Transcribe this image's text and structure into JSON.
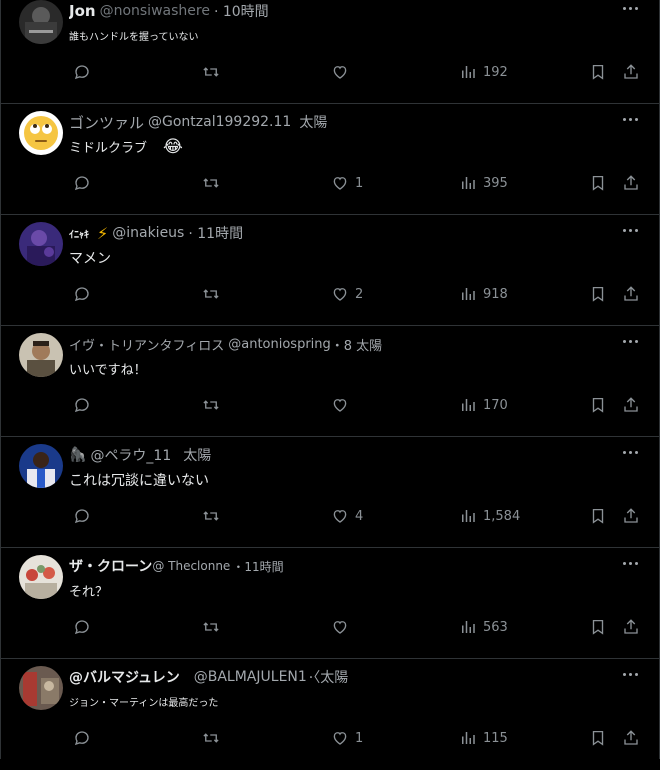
{
  "posts": [
    {
      "name": "Jon",
      "handle": "@nonsiwashere",
      "time": "· 10時間",
      "text": "誰もハンドルを握っていない",
      "likes": "",
      "views": "192",
      "avatar": "avatar-bw-photo"
    },
    {
      "name": "ゴンツァル",
      "handle": "@Gontzal199292.11",
      "time": "太陽",
      "text": "ミドルクラブ",
      "emoji": "😂",
      "likes": "1",
      "views": "395",
      "avatar": "avatar-rolling-eyes-emoji"
    },
    {
      "name": "ｲﾆｬｷ",
      "bolt": "⚡",
      "handle": "@inakieus",
      "time": "· 11時間",
      "text": "マメン",
      "likes": "2",
      "views": "918",
      "avatar": "avatar-purple-photo"
    },
    {
      "name": "イヴ・トリアンタフィロス",
      "handle": "@antoniospring",
      "time": "・8 太陽",
      "text": "いいですね！",
      "likes": "",
      "views": "170",
      "avatar": "avatar-man-photo"
    },
    {
      "name": "🦍",
      "handle": "@ペラウ_11",
      "time": "太陽",
      "text": "これは冗談に違いない",
      "likes": "4",
      "views": "1,584",
      "avatar": "avatar-blue-shirt-photo"
    },
    {
      "name": "ザ・クローン",
      "handle": "@ Theclonne",
      "time": "・11時間",
      "text": "それ？",
      "likes": "",
      "views": "563",
      "avatar": "avatar-group-photo"
    },
    {
      "name": "@バルマジュレン",
      "handle": "@BALMAJULEN1",
      "time": "·〈太陽",
      "text": "ジョン・マーティンは最高だった",
      "likes": "1",
      "views": "115",
      "avatar": "avatar-red-photo"
    }
  ],
  "colors": {
    "background": "#000000",
    "divider": "#2f3336",
    "text": "#e7e9ea",
    "muted": "#71767b",
    "icon": "#8b9196"
  }
}
